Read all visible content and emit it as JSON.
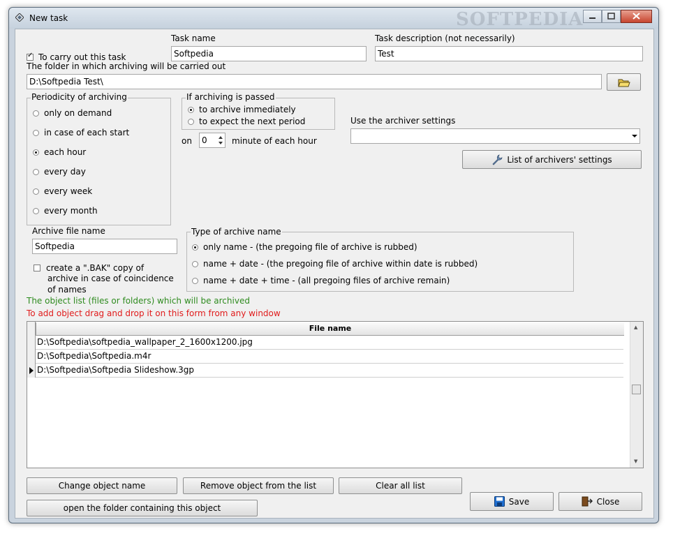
{
  "window": {
    "title": "New task",
    "watermark": "SOFTPEDIA"
  },
  "task": {
    "carry_out_label": "To carry out this task",
    "carry_out_checked": true,
    "name_label": "Task name",
    "name_value": "Softpedia",
    "desc_label": "Task description (not necessarily)",
    "desc_value": "Test"
  },
  "folder": {
    "label": "The folder in which archiving will be carried out",
    "value": "D:\\Softpedia Test\\"
  },
  "periodicity": {
    "title": "Periodicity of archiving",
    "options": [
      "only on demand",
      "in case of each start",
      "each hour",
      "every day",
      "every week",
      "every month"
    ],
    "selected": 2
  },
  "passed": {
    "title": "If archiving is passed",
    "options": [
      "to archive immediately",
      "to expect the next period"
    ],
    "selected": 0
  },
  "minute": {
    "on_label": "on",
    "value": "0",
    "suffix": "minute of each hour"
  },
  "archiver": {
    "label": "Use the archiver settings",
    "value": "",
    "list_button": "List of archivers' settings"
  },
  "archive_file": {
    "label": "Archive file name",
    "value": "Softpedia",
    "bak_line1": "create a \".BAK\" copy of",
    "bak_line2": "archive in case of coincidence",
    "bak_line3": "of names",
    "bak_checked": false
  },
  "name_type": {
    "title": "Type of archive name",
    "options": [
      "only name - (the pregoing file of archive is rubbed)",
      "name + date - (the pregoing file of archive within date is rubbed)",
      "name + date + time - (all pregoing files of archive remain)"
    ],
    "selected": 0
  },
  "objects": {
    "info_green": "The object list (files or folders) which will be archived",
    "info_red": "To add object drag and drop it on this form from any window",
    "column_header": "File name",
    "rows": [
      "D:\\Softpedia\\softpedia_wallpaper_2_1600x1200.jpg",
      "D:\\Softpedia\\Softpedia.m4r",
      "D:\\Softpedia\\Softpedia Slideshow.3gp"
    ]
  },
  "buttons": {
    "change": "Change object name",
    "remove": "Remove object from the list",
    "clear": "Clear all list",
    "open_folder": "open the folder containing this object",
    "save": "Save",
    "close": "Close"
  },
  "colors": {
    "info_green": "#2e8b1f",
    "info_red": "#e01b1b",
    "save_icon": "#1f6fd1"
  }
}
